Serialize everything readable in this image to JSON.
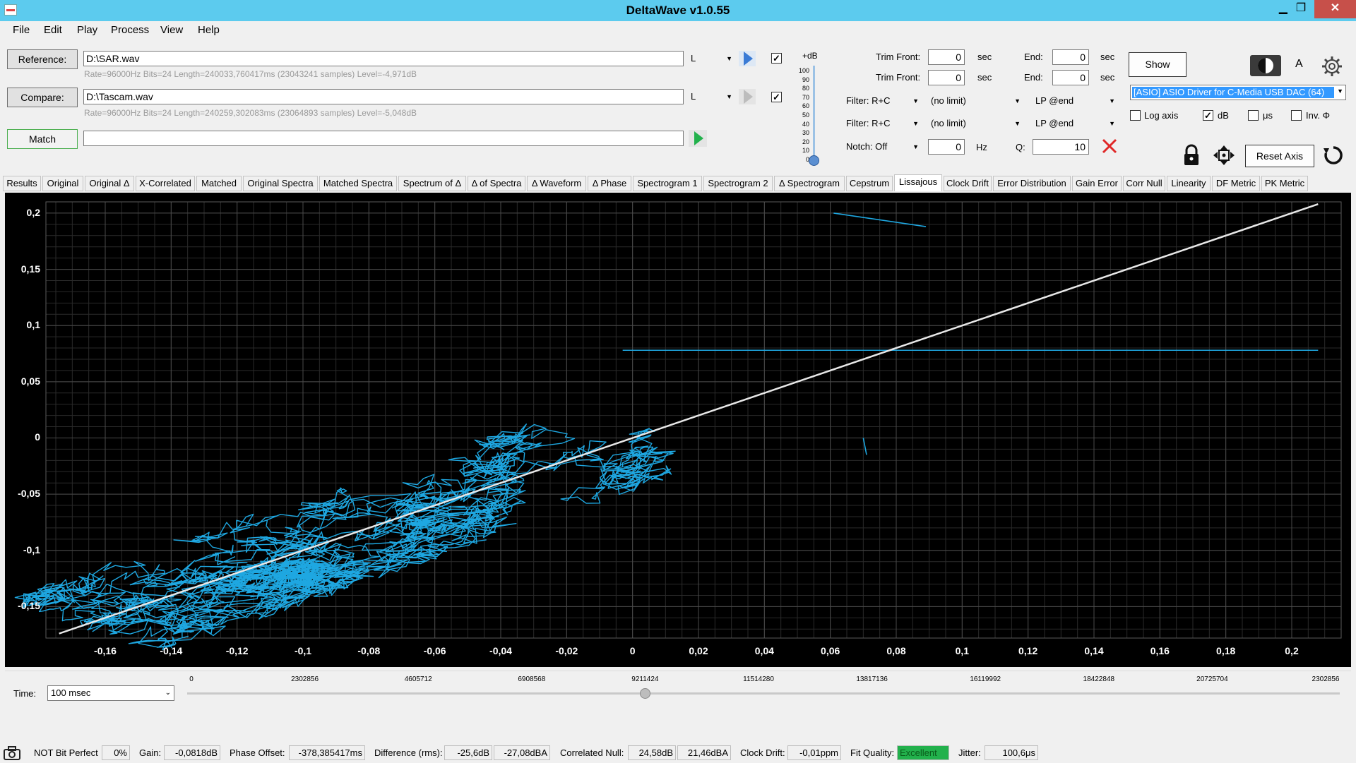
{
  "window": {
    "title": "DeltaWave v1.0.55",
    "min_glyph": "▁",
    "max_glyph": "❐",
    "close_glyph": "✕"
  },
  "menu": [
    "File",
    "Edit",
    "Play",
    "Process",
    "View",
    "Help"
  ],
  "reference": {
    "button": "Reference:",
    "path": "D:\\SAR.wav",
    "channel": "L",
    "info": "Rate=96000Hz Bits=24 Length=240033,760417ms (23043241 samples) Level=-4,971dB",
    "checked": true
  },
  "compare": {
    "button": "Compare:",
    "path": "D:\\Tascam.wav",
    "channel": "L",
    "info": "Rate=96000Hz Bits=24 Length=240259,302083ms (23064893 samples) Level=-5,048dB",
    "checked": true
  },
  "match": {
    "button": "Match",
    "value": ""
  },
  "level_meter": {
    "label": "+dB",
    "ticks": [
      "100",
      "90",
      "80",
      "70",
      "60",
      "50",
      "40",
      "30",
      "20",
      "10",
      "0"
    ],
    "level": 0
  },
  "trim": {
    "row1": {
      "front_label": "Trim Front:",
      "front_value": "0",
      "front_unit": "sec",
      "end_label": "End:",
      "end_value": "0",
      "end_unit": "sec"
    },
    "row2": {
      "front_label": "Trim Front:",
      "front_value": "0",
      "front_unit": "sec",
      "end_label": "End:",
      "end_value": "0",
      "end_unit": "sec"
    }
  },
  "filters": {
    "row1": {
      "type": "Filter: R+C",
      "limit": "(no limit)",
      "lp": "LP @end"
    },
    "row2": {
      "type": "Filter: R+C",
      "limit": "(no limit)",
      "lp": "LP @end"
    },
    "notch": {
      "type": "Notch: Off",
      "hz_value": "0",
      "hz_unit": "Hz",
      "q_label": "Q:",
      "q_value": "10"
    }
  },
  "right_panel": {
    "show_button": "Show",
    "a_label": "A",
    "device": "[ASIO] ASIO Driver for C-Media USB DAC (64)",
    "options": [
      {
        "label": "Log axis",
        "checked": false
      },
      {
        "label": "dB",
        "checked": true
      },
      {
        "label": "μs",
        "checked": false
      },
      {
        "label": "Inv. Φ",
        "checked": false
      }
    ],
    "reset_axis": "Reset Axis"
  },
  "tabs": [
    "Results",
    "Original",
    "Original Δ",
    "X-Correlated",
    "Matched",
    "Original Spectra",
    "Matched Spectra",
    "Spectrum of Δ",
    "Δ of Spectra",
    "Δ Waveform",
    "Δ Phase",
    "Spectrogram 1",
    "Spectrogram 2",
    "Δ Spectrogram",
    "Cepstrum",
    "Lissajous",
    "Clock Drift",
    "Error Distribution",
    "Gain Error",
    "Corr Null",
    "Linearity",
    "DF Metric",
    "PK Metric"
  ],
  "active_tab": "Lissajous",
  "chart_data": {
    "type": "scatter",
    "title": "",
    "xlabel": "",
    "ylabel": "",
    "xlim": [
      -0.178,
      0.215
    ],
    "ylim": [
      -0.178,
      0.21
    ],
    "grid": true,
    "x_ticks": [
      "-0,16",
      "-0,14",
      "-0,12",
      "-0,1",
      "-0,08",
      "-0,06",
      "-0,04",
      "-0,02",
      "0",
      "0,02",
      "0,04",
      "0,06",
      "0,08",
      "0,1",
      "0,12",
      "0,14",
      "0,16",
      "0,18",
      "0,2"
    ],
    "x_tick_values": [
      -0.16,
      -0.14,
      -0.12,
      -0.1,
      -0.08,
      -0.06,
      -0.04,
      -0.02,
      0,
      0.02,
      0.04,
      0.06,
      0.08,
      0.1,
      0.12,
      0.14,
      0.16,
      0.18,
      0.2
    ],
    "y_ticks": [
      "0,2",
      "0,15",
      "0,1",
      "0,05",
      "0",
      "-0,05",
      "-0,1",
      "-0,15"
    ],
    "y_tick_values": [
      0.2,
      0.15,
      0.1,
      0.05,
      0,
      -0.05,
      -0.1,
      -0.15
    ],
    "reference_line": {
      "from": [
        -0.174,
        -0.174
      ],
      "to": [
        0.208,
        0.208
      ],
      "color": "#e8e8e8"
    },
    "trace_color": "#1ea7e1",
    "trace_envelope": {
      "center_line": [
        [
          -0.174,
          -0.174
        ],
        [
          0.208,
          0.208
        ]
      ],
      "spread": 0.035
    },
    "outliers": [
      {
        "from": [
          -0.003,
          0.078
        ],
        "to": [
          0.208,
          0.078
        ]
      },
      {
        "from": [
          0.061,
          0.2
        ],
        "to": [
          0.089,
          0.188
        ]
      },
      {
        "from": [
          0.07,
          0.0
        ],
        "to": [
          0.071,
          -0.015
        ]
      }
    ]
  },
  "timeline": {
    "label": "Time:",
    "select": "100 msec",
    "marks": [
      "0",
      "2302856",
      "4605712",
      "6908568",
      "9211424",
      "11514280",
      "13817136",
      "16119992",
      "18422848",
      "20725704",
      "2302856"
    ],
    "position_fraction": 0.4
  },
  "status": {
    "bit_perfect_label": "NOT Bit Perfect",
    "bit_perfect_value": "0%",
    "gain_label": "Gain:",
    "gain_value": "-0,0818dB",
    "phase_label": "Phase Offset:",
    "phase_value": "-378,385417ms",
    "diff_label": "Difference (rms):",
    "diff_value1": "-25,6dB",
    "diff_value2": "-27,08dBA",
    "null_label": "Correlated Null:",
    "null_value1": "24,58dB",
    "null_value2": "21,46dBA",
    "drift_label": "Clock Drift:",
    "drift_value": "-0,01ppm",
    "fit_label": "Fit Quality:",
    "fit_value": "Excellent",
    "jitter_label": "Jitter:",
    "jitter_value": "100,6μs"
  }
}
